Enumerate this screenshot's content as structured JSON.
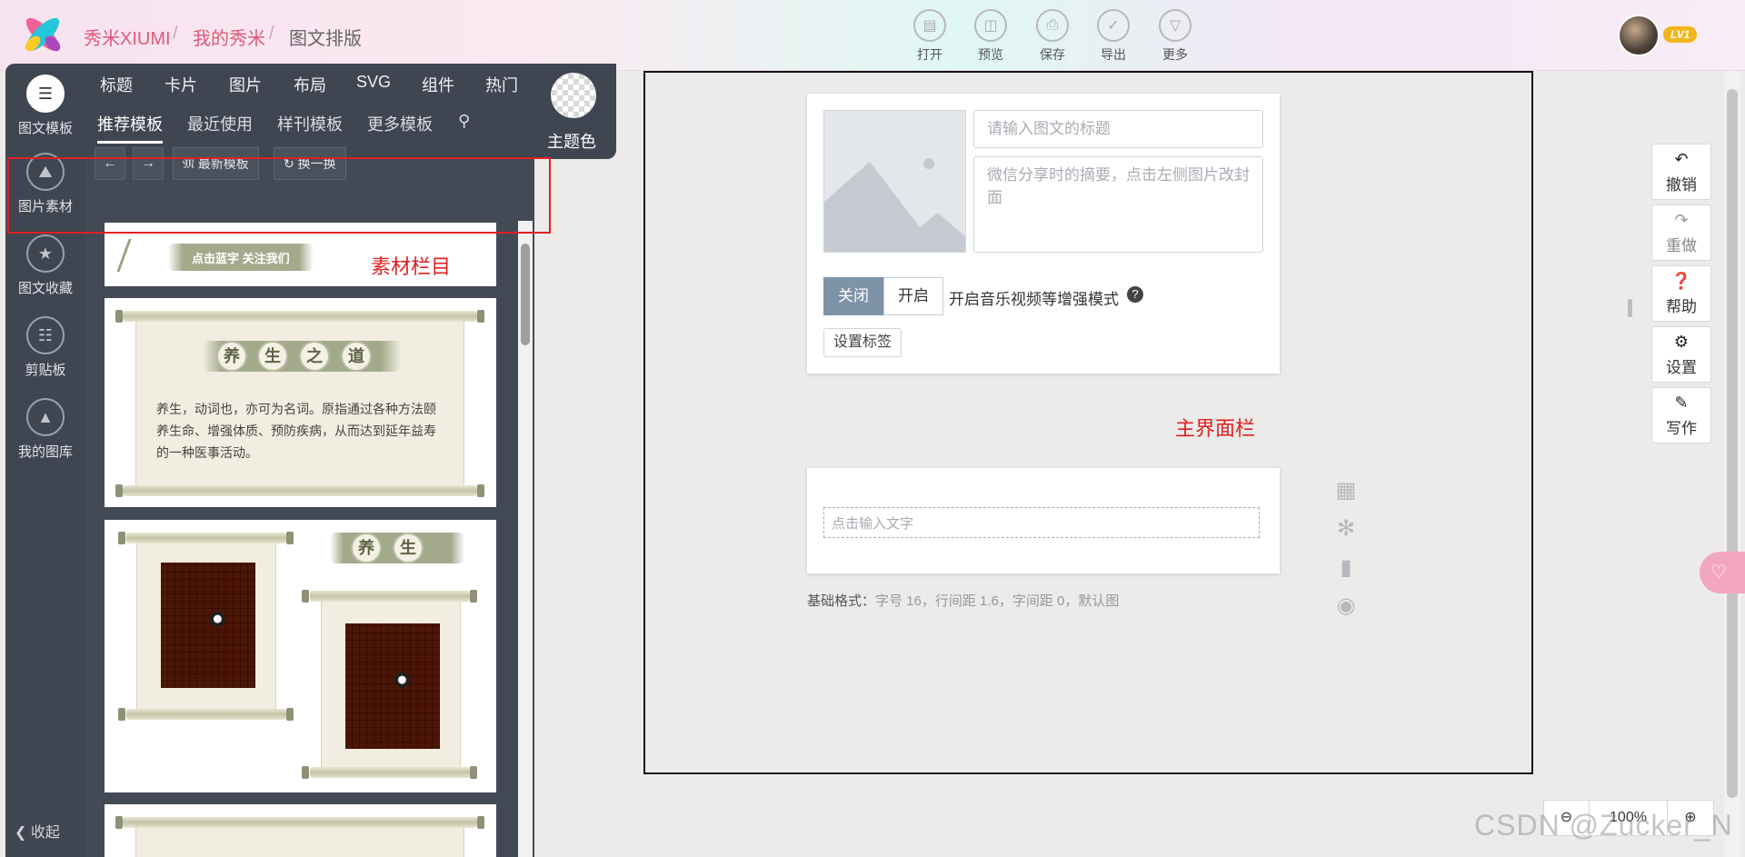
{
  "header": {
    "breadcrumb": [
      "秀米XIUMI",
      "我的秀米",
      "图文排版"
    ],
    "toolbar": [
      {
        "label": "打开",
        "icon": "folder-icon"
      },
      {
        "label": "预览",
        "icon": "preview-icon"
      },
      {
        "label": "保存",
        "icon": "save-icon"
      },
      {
        "label": "导出",
        "icon": "export-icon"
      },
      {
        "label": "更多",
        "icon": "more-icon"
      }
    ],
    "level_badge": "LV1"
  },
  "sidebar": {
    "items": [
      {
        "label": "图文模板",
        "icon": "template-icon"
      },
      {
        "label": "图片素材",
        "icon": "image-icon"
      },
      {
        "label": "图文收藏",
        "icon": "favorites-icon"
      },
      {
        "label": "剪贴板",
        "icon": "clipboard-icon"
      },
      {
        "label": "我的图库",
        "icon": "gallery-icon"
      }
    ],
    "collapse": "收起"
  },
  "categories": {
    "row1": [
      "标题",
      "卡片",
      "图片",
      "布局",
      "SVG",
      "组件",
      "热门"
    ],
    "row2": [
      "推荐模板",
      "最近使用",
      "样刊模板",
      "更多模板"
    ],
    "theme_label": "主题色",
    "latest_button": "最新模板",
    "shuffle_button": "换一换"
  },
  "templates": {
    "banner_text": "点击蓝字 关注我们",
    "card2_title_chars": [
      "养",
      "生",
      "之",
      "道"
    ],
    "card2_body": "养生，动词也，亦可为名词。原指通过各种方法颐养生命、增强体质、预防疾病，从而达到延年益寿的一种医事活动。",
    "card3_title_chars": [
      "养",
      "生"
    ]
  },
  "annotations": {
    "material_label": "素材栏目",
    "main_label": "主界面栏"
  },
  "editor": {
    "title_placeholder": "请输入图文的标题",
    "summary_placeholder": "微信分享时的摘要，点击左侧图片改封面",
    "toggle_off": "关闭",
    "toggle_on": "开启",
    "enhance_label": "开启音乐视频等增强模式",
    "tag_button": "设置标签",
    "text_placeholder": "点击输入文字",
    "format_label": "基础格式：",
    "format_value": "字号 16，行间距 1.6，字间距 0，默认图"
  },
  "right_tools": [
    {
      "label": "撤销",
      "icon": "undo-icon"
    },
    {
      "label": "重做",
      "icon": "redo-icon"
    },
    {
      "label": "帮助",
      "icon": "help-icon"
    },
    {
      "label": "设置",
      "icon": "gear-icon"
    },
    {
      "label": "写作",
      "icon": "pencil-icon"
    }
  ],
  "zoom": "100%",
  "watermark": "CSDN @Zucker_N"
}
